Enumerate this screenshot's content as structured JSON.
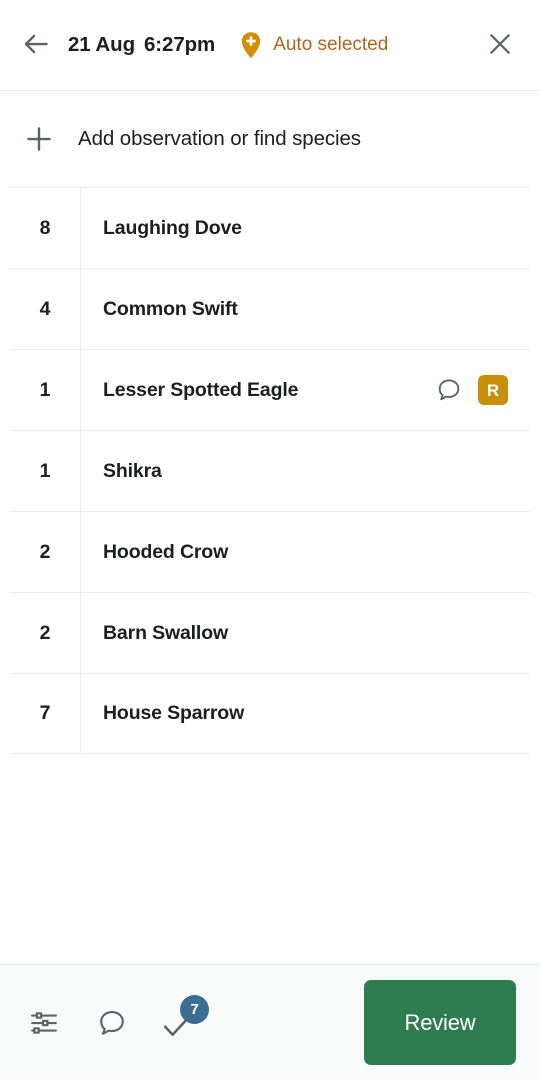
{
  "header": {
    "back_icon": "arrow-left-icon",
    "date": "21 Aug",
    "time": "6:27pm",
    "location_icon": "map-pin-plus-icon",
    "location_status": "Auto selected",
    "close_icon": "close-icon"
  },
  "add_row": {
    "plus_icon": "plus-icon",
    "label": "Add observation or find species"
  },
  "species": {
    "columns": [
      "count",
      "name"
    ],
    "rows": [
      {
        "count": "8",
        "name": "Laughing Dove",
        "has_comment": false,
        "badge": null
      },
      {
        "count": "4",
        "name": "Common Swift",
        "has_comment": false,
        "badge": null
      },
      {
        "count": "1",
        "name": "Lesser Spotted Eagle",
        "has_comment": true,
        "badge": "R"
      },
      {
        "count": "1",
        "name": "Shikra",
        "has_comment": false,
        "badge": null
      },
      {
        "count": "2",
        "name": "Hooded Crow",
        "has_comment": false,
        "badge": null
      },
      {
        "count": "2",
        "name": "Barn Swallow",
        "has_comment": false,
        "badge": null
      },
      {
        "count": "7",
        "name": "House Sparrow",
        "has_comment": false,
        "badge": null
      }
    ]
  },
  "bottom_bar": {
    "sliders_icon": "sliders-icon",
    "comments_icon": "comment-icon",
    "check_icon": "check-icon",
    "species_count": "7",
    "review_label": "Review"
  },
  "colors": {
    "accent_amber": "#c8900a",
    "pin_amber": "#d19000",
    "auto_text": "#b4651a",
    "badge_blue": "#3b6e91",
    "review_green": "#2f7d4e",
    "icon_gray": "#5a6468",
    "text_dark": "#1c1f1e",
    "divider": "#eceeed"
  }
}
